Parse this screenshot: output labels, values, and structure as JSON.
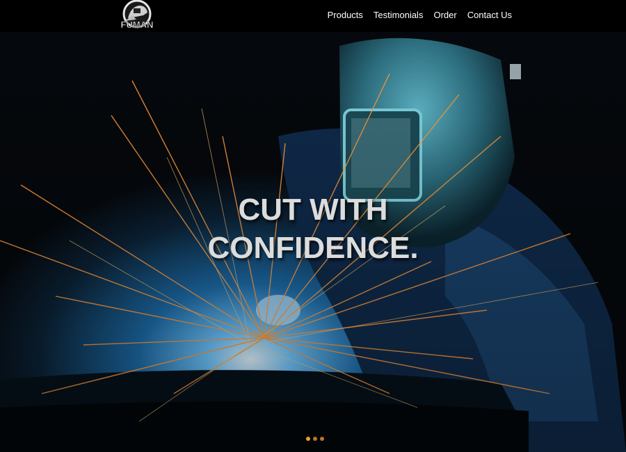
{
  "brand": {
    "logo_text": "FUMAN"
  },
  "nav": {
    "items": [
      {
        "label": "Products"
      },
      {
        "label": "Testimonials"
      },
      {
        "label": "Order"
      },
      {
        "label": "Contact Us"
      }
    ]
  },
  "hero": {
    "title_line1": "CUT WITH",
    "title_line2": "CONFIDENCE.",
    "image": "welder-with-sparks"
  },
  "carousel": {
    "slide_count": 3,
    "active_index": 0,
    "colors": {
      "active": "#e8a32a",
      "inactive": "#b8742a"
    }
  }
}
